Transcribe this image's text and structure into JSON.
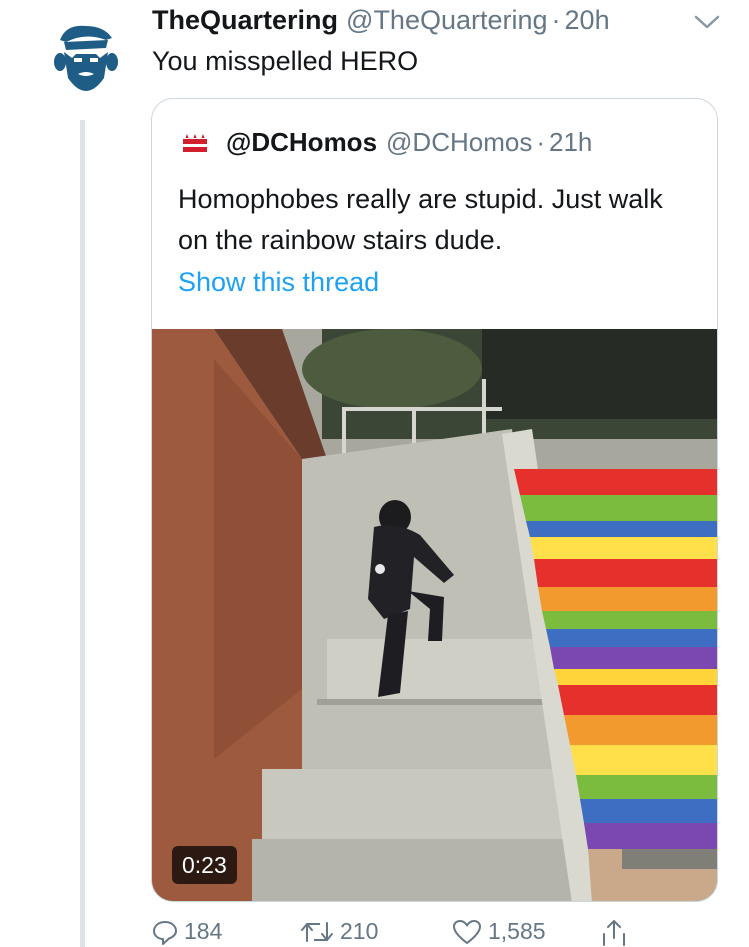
{
  "tweet": {
    "author_name": "TheQuartering",
    "author_handle": "@TheQuartering",
    "separator": "·",
    "time": "20h",
    "text": "You misspelled HERO",
    "avatar_icon": "bearded-man-icon",
    "menu_icon": "chevron-down-icon"
  },
  "quote": {
    "author_name": "@DCHomos",
    "author_handle": "@DCHomos",
    "separator": "·",
    "time": "21h",
    "text": "Homophobes really are stupid. Just walk on the rainbow stairs dude.",
    "link": "Show this thread",
    "avatar_icon": "dc-flag-icon",
    "media": {
      "type": "video",
      "duration": "0:23"
    }
  },
  "actions": {
    "reply_count": "184",
    "retweet_count": "210",
    "like_count": "1,585",
    "reply_icon": "reply-icon",
    "retweet_icon": "retweet-icon",
    "like_icon": "heart-icon",
    "share_icon": "share-icon"
  },
  "colors": {
    "link": "#1da1f2",
    "secondary_text": "#657786",
    "border": "#ccd6dd",
    "avatar": "#1f5c86"
  }
}
